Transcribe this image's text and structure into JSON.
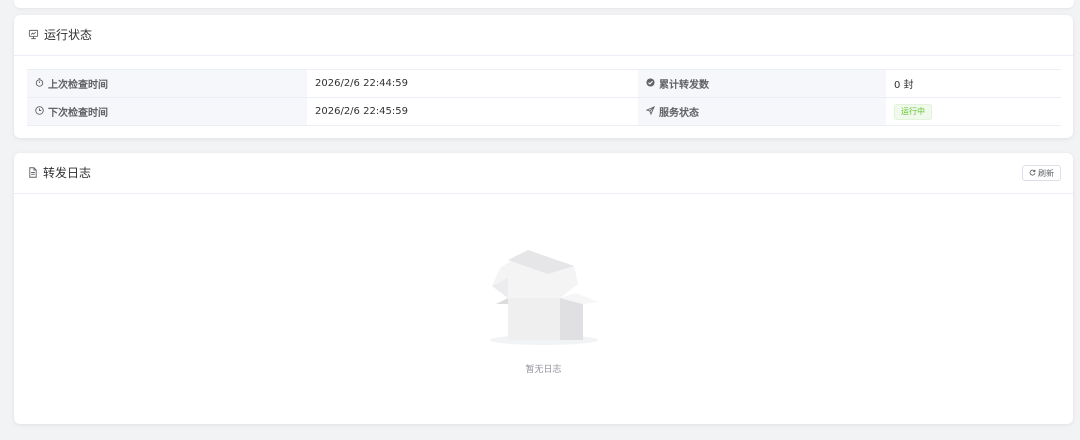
{
  "status_card": {
    "title": "运行状态",
    "rows": [
      {
        "left_label": "上次检查时间",
        "left_value": "2026/2/6 22:44:59",
        "right_label": "累计转发数",
        "right_value": "0 封"
      },
      {
        "left_label": "下次检查时间",
        "left_value": "2026/2/6 22:45:59",
        "right_label": "服务状态",
        "right_value": "运行中"
      }
    ],
    "icons": {
      "title": "monitor-icon",
      "last_check": "stopwatch-icon",
      "next_check": "clock-icon",
      "total": "check-circle-icon",
      "service": "send-icon"
    },
    "status_color": "#67c23a"
  },
  "log_card": {
    "title": "转发日志",
    "refresh_label": "刷新",
    "empty_text": "暂无日志",
    "icons": {
      "title": "document-icon",
      "refresh": "refresh-icon",
      "empty": "empty-box-icon"
    }
  }
}
